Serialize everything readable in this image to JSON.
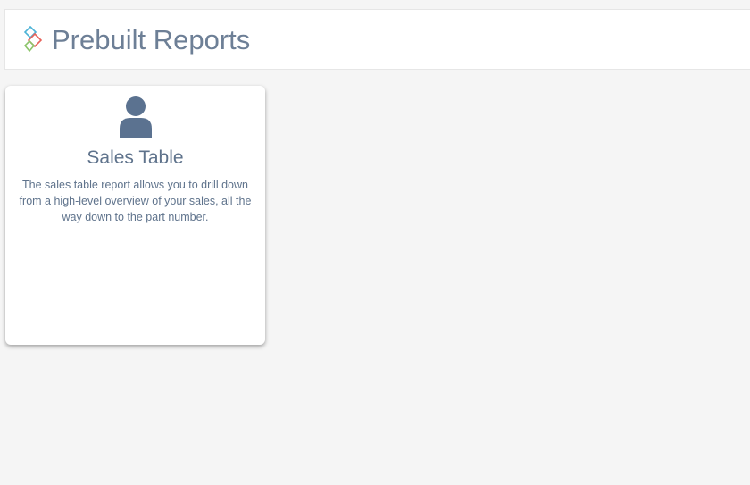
{
  "header": {
    "title": "Prebuilt Reports",
    "logo_icon": "report-logo-icon"
  },
  "cards": [
    {
      "title": "Sales Table",
      "icon": "user-icon",
      "description": "The sales table report allows you to drill down from a high-level overview of your sales, all the way down to the part number."
    }
  ],
  "colors": {
    "background": "#f5f5f5",
    "title_text": "#6d7f96",
    "card_text": "#5f738c",
    "icon_fill": "#5b7290",
    "logo_blue": "#4db3d6",
    "logo_red": "#e8625a",
    "logo_green": "#8cc46a"
  }
}
